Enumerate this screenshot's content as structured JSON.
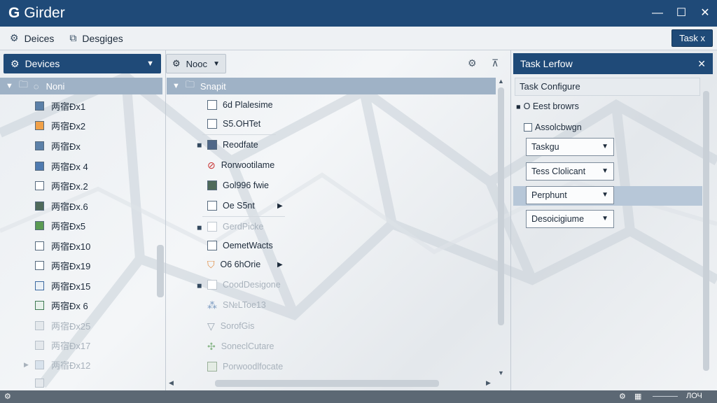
{
  "app": {
    "title": "Girder",
    "logo": "G"
  },
  "window": {
    "minimize": "—",
    "maximize": "☐",
    "close": "✕"
  },
  "toolbar": {
    "devices_label": "Deices",
    "designs_label": "Desgiges",
    "task_label": "Task x"
  },
  "left_panel": {
    "header": "Devices",
    "selected": "Noni",
    "items": [
      "两宿Đx1",
      "两宿Đx2",
      "两宿Đx",
      "两宿Đx 4",
      "两宿Đx.2",
      "两宿Đx.6",
      "两宿Đx5",
      "两宿Đx10",
      "两宿Đx19",
      "两宿Đx15",
      "两宿Đx 6",
      "两宿Đx25",
      "两宿Đx17",
      "两宿Đx12"
    ]
  },
  "middle_panel": {
    "dropdown": "Nooc",
    "selected": "Snapit",
    "items": [
      "6d Plalesime",
      "S5.OHTet",
      "Reodfate",
      "Rorwootilame",
      "Gol996 fwie",
      "Oe S5nt",
      "GerdPicke",
      "OemetWacts",
      "O6 6hOrie",
      "CoodDesigone",
      "S№LToe13",
      "SorofGis",
      "SoneclCutare",
      "Porwoodlfocate"
    ]
  },
  "tasks_panel": {
    "header": "Task Lerfow",
    "close": "✕",
    "subheader": "Task Configure",
    "radio_label": "O Eest browrs",
    "checkbox_label": "Assolcbwgn",
    "dropdowns": [
      "Taskgu",
      "Tess Clolicant",
      "Perphunt",
      "Desoicigiume"
    ]
  },
  "statusbar": {
    "zoom": "ЛОЧ"
  },
  "colors": {
    "accent": "#1f4a78",
    "selection": "#9fb2c6",
    "status_bar": "#5c6874"
  }
}
